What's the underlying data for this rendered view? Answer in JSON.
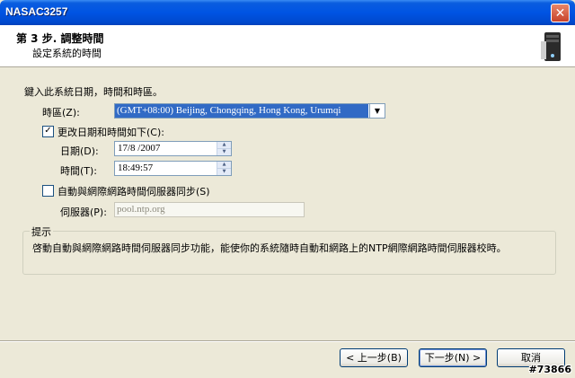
{
  "window": {
    "title": "NASAC3257",
    "close_glyph": "✕"
  },
  "header": {
    "step_title": "第 3 步. 調整時間",
    "subtitle": "設定系統的時間"
  },
  "intro": "鍵入此系統日期，時間和時區。",
  "timezone": {
    "label": "時區(Z):",
    "value": "(GMT+08:00) Beijing, Chongqing, Hong Kong, Urumqi"
  },
  "change_datetime": {
    "label": "更改日期和時間如下(C):",
    "checked": true
  },
  "date": {
    "label": "日期(D):",
    "value": "17/8 /2007"
  },
  "time": {
    "label": "時間(T):",
    "value": "18:49:57"
  },
  "ntp_sync": {
    "label": "自動與網際網路時間伺服器同步(S)",
    "checked": false
  },
  "server": {
    "label": "伺服器(P):",
    "value": "pool.ntp.org"
  },
  "hint": {
    "title": "提示",
    "text": "啓動自動與網際網路時間伺服器同步功能，能使你的系統隨時自動和網路上的NTP網際網路時間伺服器校時。"
  },
  "buttons": {
    "back": "< 上一步(B)",
    "next": "下一步(N) >",
    "cancel": "取消"
  },
  "watermark": "#73866",
  "colors": {
    "titlebar": "#0054e3",
    "selection": "#316ac5",
    "dialog_bg": "#ece9d8"
  }
}
